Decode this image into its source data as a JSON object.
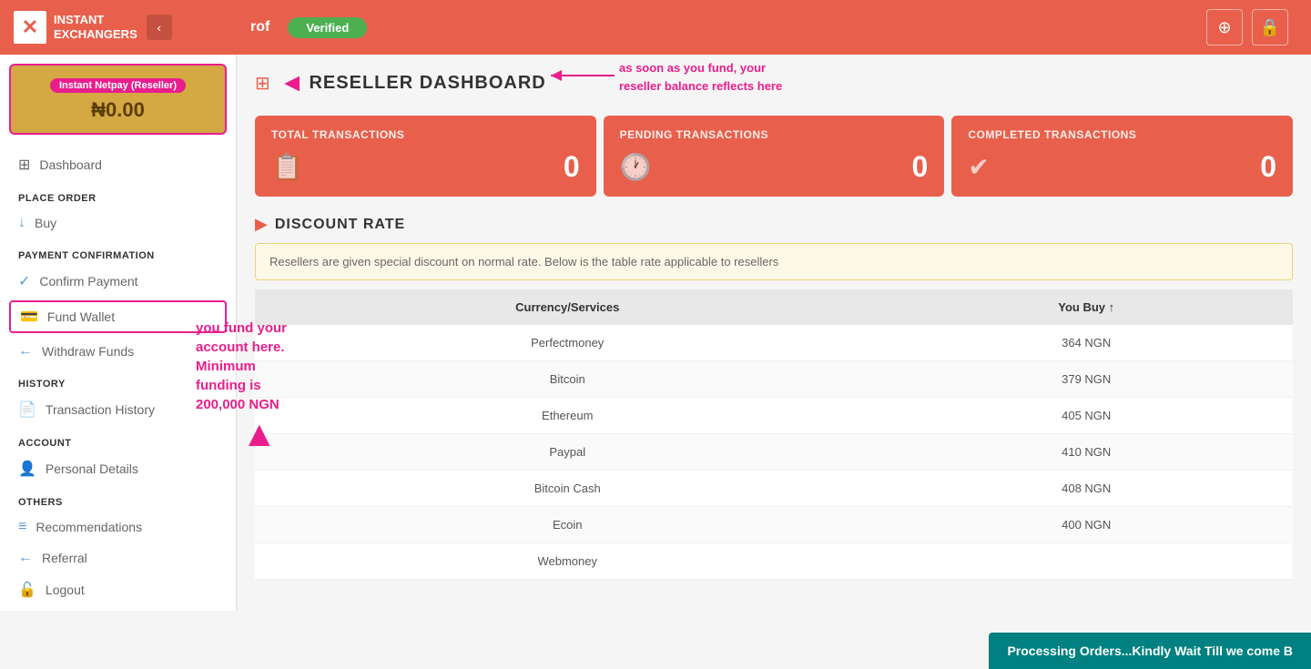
{
  "header": {
    "logo_line1": "INSTANT",
    "logo_line2": "EXCHANGERS",
    "username": "rof",
    "verified_label": "Verified",
    "android_icon": "android",
    "lock_icon": "lock"
  },
  "sidebar": {
    "balance_card": {
      "label": "Instant Netpay (Reseller)",
      "amount": "₦0.00"
    },
    "nav_items": [
      {
        "section": null,
        "icon": "⊞",
        "label": "Dashboard",
        "name": "dashboard"
      },
      {
        "section": "PLACE ORDER",
        "icon": "↓",
        "label": "Buy",
        "name": "buy"
      },
      {
        "section": "PAYMENT CONFIRMATION",
        "icon": "✓",
        "label": "Confirm Payment",
        "name": "confirm-payment"
      },
      {
        "section": null,
        "icon": "💳",
        "label": "Fund Wallet",
        "name": "fund-wallet",
        "active": true
      },
      {
        "section": null,
        "icon": "←",
        "label": "Withdraw Funds",
        "name": "withdraw-funds"
      },
      {
        "section": "HISTORY",
        "icon": "📄",
        "label": "Transaction History",
        "name": "transaction-history"
      },
      {
        "section": "ACCOUNT",
        "icon": "👤",
        "label": "Personal Details",
        "name": "personal-details"
      },
      {
        "section": "OTHERS",
        "icon": "≡",
        "label": "Recommendations",
        "name": "recommendations"
      },
      {
        "section": null,
        "icon": "←",
        "label": "Referral",
        "name": "referral"
      },
      {
        "section": null,
        "icon": "🔓",
        "label": "Logout",
        "name": "logout"
      }
    ]
  },
  "dashboard": {
    "title": "RESELLER DASHBOARD",
    "annotation_top": "as soon as you fund, your\nreseller balance reflects here",
    "stats": [
      {
        "label": "TOTAL TRANSACTIONS",
        "value": "0",
        "icon": "doc"
      },
      {
        "label": "PENDING TRANSACTIONS",
        "value": "0",
        "icon": "clock"
      },
      {
        "label": "COMPLETED TRANSACTIONS",
        "value": "0",
        "icon": "check"
      }
    ],
    "discount": {
      "title": "DISCOUNT RATE",
      "info": "Resellers are given special discount on normal rate. Below is the table rate applicable to resellers",
      "table_headers": [
        "Currency/Services",
        "You Buy ↑"
      ],
      "rows": [
        {
          "currency": "Perfectmoney",
          "rate": "364 NGN"
        },
        {
          "currency": "Bitcoin",
          "rate": "379 NGN"
        },
        {
          "currency": "Ethereum",
          "rate": "405 NGN"
        },
        {
          "currency": "Paypal",
          "rate": "410 NGN"
        },
        {
          "currency": "Bitcoin Cash",
          "rate": "408 NGN"
        },
        {
          "currency": "Ecoin",
          "rate": "400 NGN"
        },
        {
          "currency": "Webmoney",
          "rate": ""
        }
      ]
    }
  },
  "annotations": {
    "fund_wallet": "you fund your\naccount here.\nMinimum\nfunding is\n200,000 NGN"
  },
  "processing_banner": "Processing Orders...Kindly Wait Till we come B"
}
